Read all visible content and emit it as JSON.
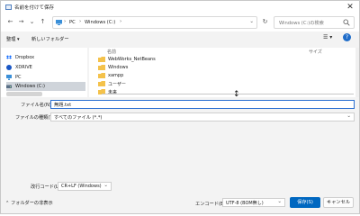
{
  "window": {
    "title": "名前を付けて保存",
    "close": "✕"
  },
  "nav": {
    "back": "←",
    "forward": "→",
    "up_dropdown": "⌄",
    "up": "↑",
    "breadcrumb": [
      "PC",
      "Windows (C:)"
    ],
    "crumb_sep": "›",
    "address_dropdown": "⌄",
    "refresh": "↻",
    "search_placeholder": "Windows (C:)の検索"
  },
  "toolbar": {
    "organize": "整理 ▾",
    "new_folder": "新しいフォルダー",
    "view": "☰ ▾",
    "help": "?"
  },
  "sidebar": {
    "items": [
      {
        "label": "Dropbox",
        "icon": "dropbox-icon",
        "color": "#0061fe"
      },
      {
        "label": "XDRIVE",
        "icon": "xdrive-icon",
        "color": "#1a57c5"
      },
      {
        "label": "PC",
        "icon": "pc-icon",
        "color": "#3a8fd8"
      },
      {
        "label": "Windows (C:)",
        "icon": "drive-icon",
        "color": "#5a6f86"
      }
    ]
  },
  "file_list": {
    "columns": {
      "name": "名前",
      "size": "サイズ"
    },
    "items": [
      "WebWorks_NetBeans",
      "Windows",
      "xampp",
      "ユーザー",
      "未来"
    ]
  },
  "form": {
    "file_name_label": "ファイル名(N):",
    "file_name_value": "無題.txt",
    "file_type_label": "ファイルの種類(T):",
    "file_type_value": "すべてのファイル (*.*)",
    "line_break_label": "改行コード(L):",
    "line_break_value": "CR+LF (Windows)",
    "encoding_label": "エンコード(E):",
    "encoding_value": "UTF-8 (BOM無し)"
  },
  "footer": {
    "hide_folders": "⌃ フォルダーの非表示",
    "save": "保存(S)",
    "cancel": "キャンセル"
  },
  "colors": {
    "accent": "#0067c0",
    "folder": "#f4c24b",
    "selected": "#cfd4da"
  }
}
